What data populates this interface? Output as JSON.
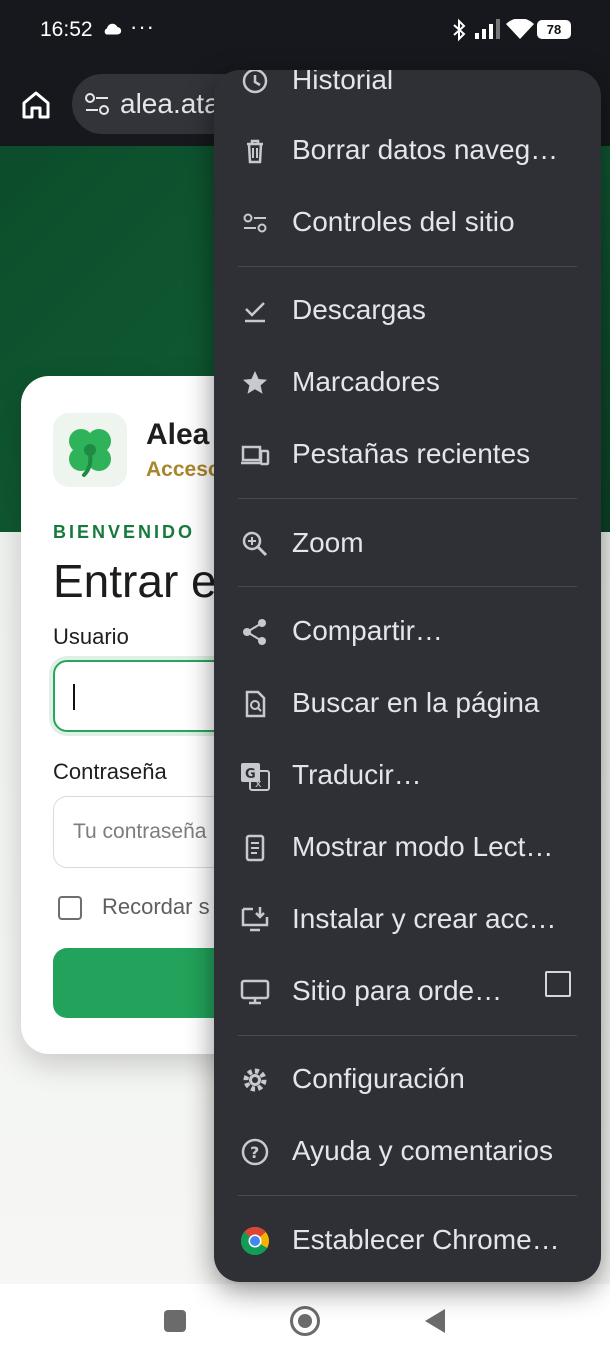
{
  "status_bar": {
    "time": "16:52",
    "overflow": "···",
    "battery": "78",
    "icons": [
      "cloud-icon",
      "bluetooth-icon",
      "signal-icon",
      "wifi-icon",
      "battery-icon"
    ]
  },
  "toolbar": {
    "url": "alea.ata"
  },
  "page": {
    "app_name": "Alea",
    "app_subtitle": "Acceso",
    "welcome": "BIENVENIDO",
    "title": "Entrar e",
    "user_label": "Usuario",
    "password_label": "Contraseña",
    "password_placeholder": "Tu contraseña",
    "remember_label": "Recordar s",
    "colors": {
      "hero": "#0f5a32",
      "accent": "#22a25a",
      "subtitle": "#a8862c"
    }
  },
  "menu": {
    "items": [
      {
        "label": "Historial",
        "icon": "history-icon"
      },
      {
        "label": "Borrar datos naveg…",
        "icon": "trash-icon"
      },
      {
        "label": "Controles del sitio",
        "icon": "tune-icon"
      },
      {
        "label": "Descargas",
        "icon": "download-done-icon"
      },
      {
        "label": "Marcadores",
        "icon": "star-icon"
      },
      {
        "label": "Pestañas recientes",
        "icon": "devices-icon"
      },
      {
        "label": "Zoom",
        "icon": "zoom-in-icon"
      },
      {
        "label": "Compartir…",
        "icon": "share-icon"
      },
      {
        "label": "Buscar en la página",
        "icon": "find-in-page-icon"
      },
      {
        "label": "Traducir…",
        "icon": "translate-icon"
      },
      {
        "label": "Mostrar modo Lect…",
        "icon": "reader-mode-icon"
      },
      {
        "label": "Instalar y crear acc…",
        "icon": "install-app-icon"
      },
      {
        "label": "Sitio para orde…",
        "icon": "desktop-icon",
        "checked": false
      },
      {
        "label": "Configuración",
        "icon": "settings-icon"
      },
      {
        "label": "Ayuda y comentarios",
        "icon": "help-icon"
      },
      {
        "label": "Establecer Chrome…",
        "icon": "chrome-icon"
      }
    ]
  },
  "nav_bar": {
    "icons": [
      "recents-icon",
      "home-circle-icon",
      "back-icon"
    ]
  }
}
